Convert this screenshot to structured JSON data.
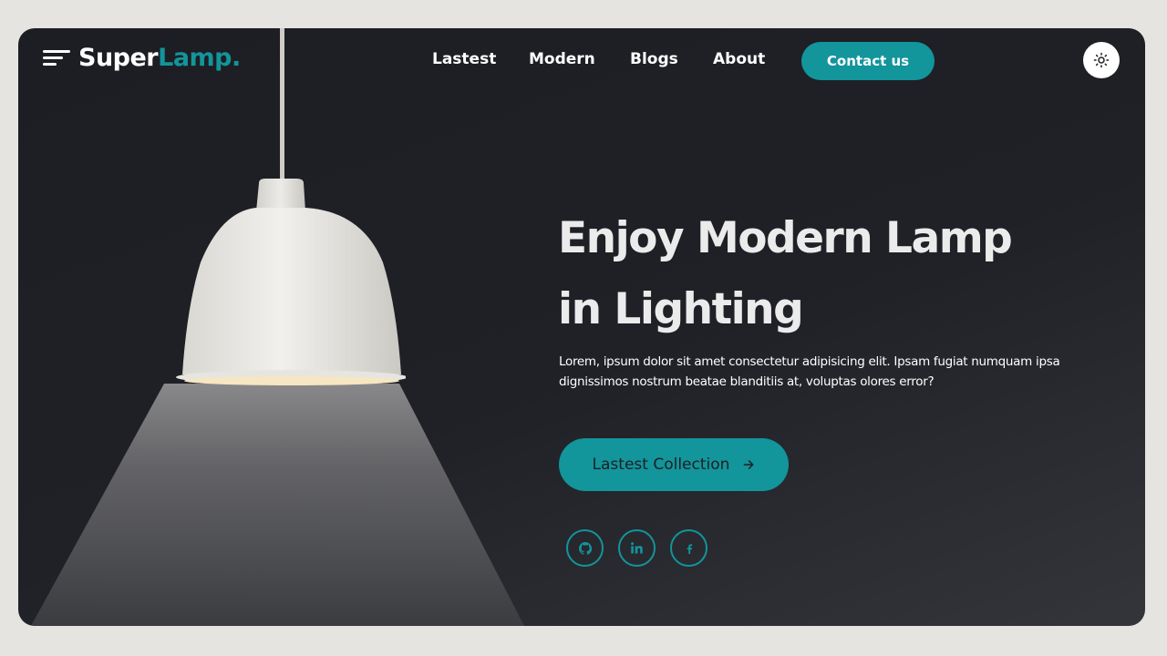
{
  "brand": {
    "name_part1": "Super",
    "name_part2": "Lamp."
  },
  "nav": {
    "links": [
      {
        "label": "Lastest"
      },
      {
        "label": "Modern"
      },
      {
        "label": "Blogs"
      },
      {
        "label": "About"
      }
    ],
    "contact_label": "Contact us",
    "theme_toggle_icon": "sun-icon",
    "menu_icon": "hamburger-menu-icon"
  },
  "hero": {
    "title_line1": "Enjoy Modern Lamp",
    "title_line2": "in Lighting",
    "description": "Lorem, ipsum dolor sit amet consectetur adipisicing elit. Ipsam fugiat numquam ipsa dignissimos nostrum beatae blanditiis at, voluptas olores error?",
    "cta_label": "Lastest Collection",
    "cta_icon": "arrow-right-icon"
  },
  "socials": [
    {
      "icon": "github-icon"
    },
    {
      "icon": "linkedin-icon"
    },
    {
      "icon": "facebook-icon"
    }
  ],
  "colors": {
    "accent": "#12959b",
    "background": "#1e2026",
    "page": "#e5e4e1"
  }
}
